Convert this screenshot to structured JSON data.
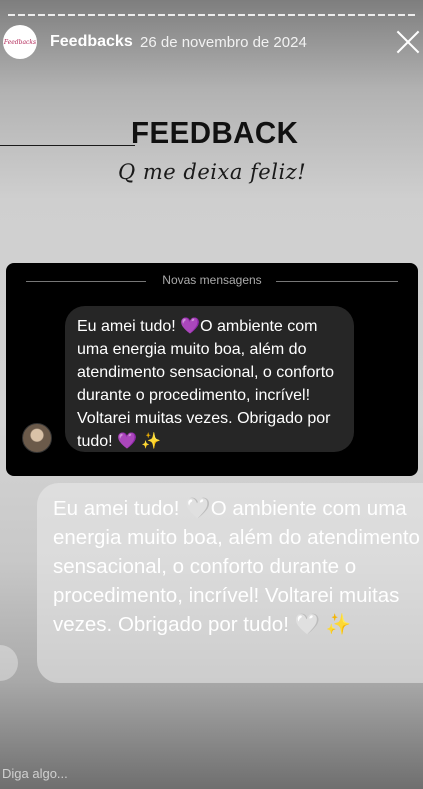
{
  "header": {
    "avatar_text": "Feedbacks",
    "account_name": "Feedbacks",
    "date": "26 de novembro de 2024"
  },
  "story": {
    "title": "FEEDBACK",
    "subtitle": "Q me deixa feliz!",
    "divider_label": "Novas mensagens",
    "message_dark": "Eu amei tudo! 💜O ambiente com uma energia muito boa, além do atendimento sensacional, o conforto durante o procedimento, incrível! Voltarei muitas vezes. Obrigado por tudo! 💜 ✨",
    "message_light": "Eu amei tudo! 🤍O ambiente com uma energia muito boa, além do atendimento sensacional, o conforto durante o procedimento, incrível! Voltarei muitas vezes. Obrigado por tudo! 🤍 ✨"
  },
  "reply": {
    "placeholder": "Diga algo..."
  },
  "icons": {
    "close": "close-icon"
  }
}
